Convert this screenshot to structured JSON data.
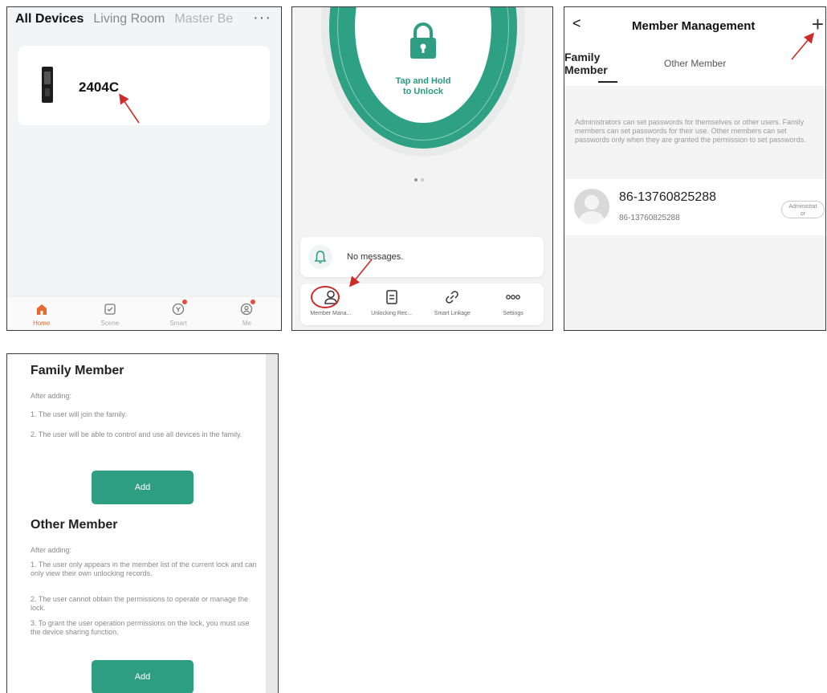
{
  "panel1": {
    "tabs": [
      "All Devices",
      "Living Room",
      "Master Be"
    ],
    "more_label": "···",
    "device": {
      "name": "2404C"
    },
    "bottom_nav": [
      {
        "label": "Home",
        "icon": "home-icon"
      },
      {
        "label": "Scene",
        "icon": "scene-icon"
      },
      {
        "label": "Smart",
        "icon": "smart-icon"
      },
      {
        "label": "Me",
        "icon": "profile-icon"
      }
    ]
  },
  "panel2": {
    "unlock_line1": "Tap and Hold",
    "unlock_line2": "to Unlock",
    "message": "No messages.",
    "actions": [
      {
        "label": "Member Mana...",
        "icon": "member-icon"
      },
      {
        "label": "Unlocking Rec...",
        "icon": "record-icon"
      },
      {
        "label": "Smart Linkage",
        "icon": "link-icon"
      },
      {
        "label": "Settings",
        "icon": "settings-dots-icon"
      }
    ]
  },
  "panel3": {
    "back": "<",
    "title": "Member Management",
    "add": "+",
    "tab_family_1": "Family",
    "tab_family_2": "Member",
    "tab_other": "Other Member",
    "info": "Administrators can set passwords for themselves or other users. Family members can set passwords for their use. Other members can set passwords only when they are granted the permission to set passwords.",
    "member": {
      "name": "86-13760825288",
      "sub": "86-13760825288",
      "role_1": "Administrat",
      "role_2": "or"
    }
  },
  "panel4": {
    "family_title": "Family Member",
    "family_lines": [
      "After adding:",
      "1. The user will join the family.",
      "2. The user will be able to control and use all devices in the family."
    ],
    "add_label": "Add",
    "other_title": "Other Member",
    "other_lines": [
      "After adding:",
      "1. The user only appears in the member list of the current lock and can only view their own unlocking records.",
      "2. The user cannot obtain the permissions to operate or manage the lock.",
      "3. To grant the user operation permissions on the lock, you must use the device sharing function."
    ]
  },
  "colors": {
    "accent": "#2e9e82",
    "annotation": "#cf2a2a",
    "home_active": "#e8692f"
  }
}
